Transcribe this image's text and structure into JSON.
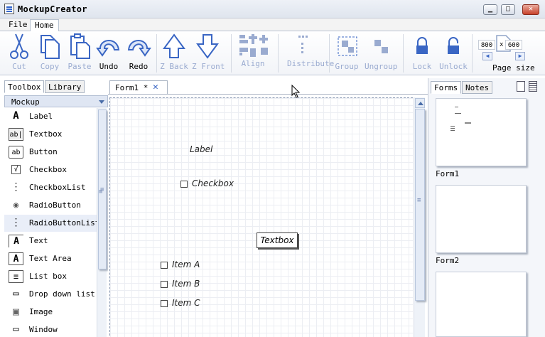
{
  "window": {
    "title": "MockupCreator"
  },
  "menu": {
    "tabs": [
      "File",
      "Home"
    ],
    "active": "Home"
  },
  "ribbon": {
    "cut": "Cut",
    "copy": "Copy",
    "paste": "Paste",
    "undo": "Undo",
    "redo": "Redo",
    "zback": "Z Back",
    "zfront": "Z Front",
    "align": "Align",
    "distribute": "Distribute",
    "group": "Group",
    "ungroup": "Ungroup",
    "lock": "Lock",
    "unlock": "Unlock",
    "page_width": "800",
    "page_x": "x",
    "page_height": "600",
    "page_size": "Page size"
  },
  "left_panel": {
    "tabs": [
      "Toolbox",
      "Library"
    ],
    "category": "Mockup",
    "tools": [
      {
        "label": "Label",
        "icon": "A"
      },
      {
        "label": "Textbox",
        "icon": "ab|"
      },
      {
        "label": "Button",
        "icon": "ab"
      },
      {
        "label": "Checkbox",
        "icon": "√"
      },
      {
        "label": "CheckboxList",
        "icon": "⋮"
      },
      {
        "label": "RadioButton",
        "icon": "◉"
      },
      {
        "label": "RadioButtonList",
        "icon": "⋮"
      },
      {
        "label": "Text",
        "icon": "A"
      },
      {
        "label": "Text Area",
        "icon": "A"
      },
      {
        "label": "List box",
        "icon": "≡"
      },
      {
        "label": "Drop down list",
        "icon": "▭"
      },
      {
        "label": "Image",
        "icon": "▣"
      },
      {
        "label": "Window",
        "icon": "▭"
      }
    ]
  },
  "document": {
    "tab": "Form1 *",
    "close": "✕",
    "widgets": {
      "label": "Label",
      "checkbox": "Checkbox",
      "textbox": "Textbox",
      "items": [
        "Item A",
        "Item B",
        "Item C"
      ]
    }
  },
  "right_panel": {
    "tabs": [
      "Forms",
      "Notes"
    ],
    "forms": [
      "Form1",
      "Form2"
    ]
  }
}
